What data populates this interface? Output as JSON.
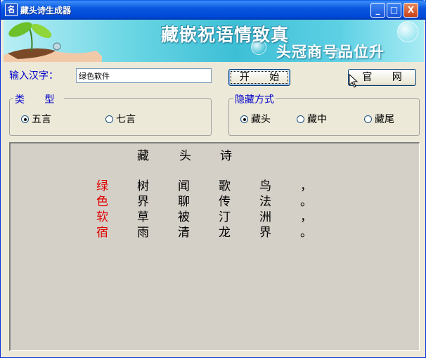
{
  "window": {
    "title": "藏头诗生成器",
    "icon_glyph": "名",
    "controls": {
      "minimize": "_",
      "maximize": "□",
      "close": "X"
    }
  },
  "banner": {
    "title": "藏嵌祝语情致真",
    "subtitle": "头冠商号品位升"
  },
  "input": {
    "label": "输入汉字：",
    "value": "绿色软件"
  },
  "buttons": {
    "start": "开 始",
    "website": "官 网"
  },
  "type_group": {
    "legend": "类 型",
    "options": [
      {
        "label": "五言",
        "checked": true
      },
      {
        "label": "七言",
        "checked": false
      }
    ]
  },
  "hide_group": {
    "legend": "隐藏方式",
    "options": [
      {
        "label": "藏头",
        "checked": true
      },
      {
        "label": "藏中",
        "checked": false
      },
      {
        "label": "藏尾",
        "checked": false
      }
    ]
  },
  "poem": {
    "header": [
      "藏",
      "头",
      "诗"
    ],
    "lines": [
      [
        "绿",
        "树",
        "闻",
        "歌",
        "鸟",
        "，"
      ],
      [
        "色",
        "界",
        "聊",
        "传",
        "法",
        "。"
      ],
      [
        "软",
        "草",
        "被",
        "汀",
        "洲",
        "，"
      ],
      [
        "宿",
        "雨",
        "清",
        "龙",
        "界",
        "。"
      ]
    ]
  },
  "colors": {
    "hidden_char": "#e00000",
    "label_blue": "#0000cc",
    "titlebar": "#0054e3"
  }
}
